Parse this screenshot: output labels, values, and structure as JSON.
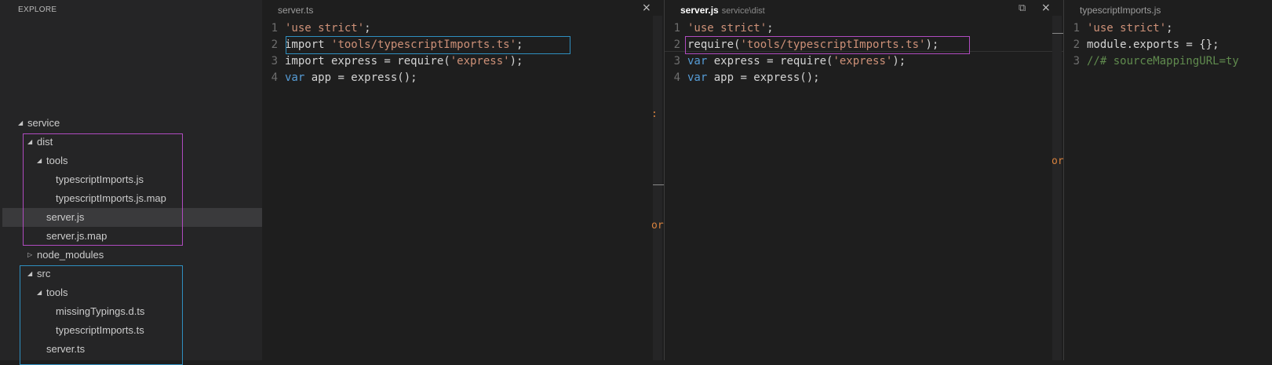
{
  "sidebar": {
    "title": "EXPLORE",
    "tree": [
      {
        "label": "service",
        "twisty": "◢"
      },
      {
        "label": "dist",
        "twisty": "◢"
      },
      {
        "label": "tools",
        "twisty": "◢"
      },
      {
        "label": "typescriptImports.js"
      },
      {
        "label": "typescriptImports.js.map"
      },
      {
        "label": "server.js",
        "selected": true
      },
      {
        "label": "server.js.map"
      },
      {
        "label": "node_modules",
        "twisty": "▷"
      },
      {
        "label": "src",
        "twisty": "◢"
      },
      {
        "label": "tools",
        "twisty": "◢"
      },
      {
        "label": "missingTypings.d.ts"
      },
      {
        "label": "typescriptImports.ts"
      },
      {
        "label": "server.ts"
      }
    ]
  },
  "editors": [
    {
      "tab": "server.ts",
      "lines": [
        {
          "n": "1",
          "tokens": [
            {
              "t": "'use strict'",
              "c": "str"
            },
            {
              "t": ";",
              "c": ""
            }
          ]
        },
        {
          "n": "2",
          "tokens": [
            {
              "t": "import ",
              "c": ""
            },
            {
              "t": "'tools/typescriptImports.ts'",
              "c": "str"
            },
            {
              "t": ";",
              "c": ""
            }
          ]
        },
        {
          "n": "3",
          "tokens": [
            {
              "t": "import express = require(",
              "c": ""
            },
            {
              "t": "'express'",
              "c": "str"
            },
            {
              "t": ");",
              "c": ""
            }
          ]
        },
        {
          "n": "4",
          "tokens": [
            {
              "t": "var",
              "c": "kw"
            },
            {
              "t": " app = express();",
              "c": ""
            }
          ]
        }
      ],
      "overflow_text": "or"
    },
    {
      "tab": "server.js",
      "tab_sub": "service\\dist",
      "lines": [
        {
          "n": "1",
          "tokens": [
            {
              "t": "'use strict'",
              "c": "str"
            },
            {
              "t": ";",
              "c": ""
            }
          ]
        },
        {
          "n": "2",
          "tokens": [
            {
              "t": "require(",
              "c": ""
            },
            {
              "t": "'tools/typescriptImports.ts'",
              "c": "str"
            },
            {
              "t": ");",
              "c": ""
            }
          ]
        },
        {
          "n": "3",
          "tokens": [
            {
              "t": "var",
              "c": "kw"
            },
            {
              "t": " express = require(",
              "c": ""
            },
            {
              "t": "'express'",
              "c": "str"
            },
            {
              "t": ");",
              "c": ""
            }
          ]
        },
        {
          "n": "4",
          "tokens": [
            {
              "t": "var",
              "c": "kw"
            },
            {
              "t": " app = express();",
              "c": ""
            }
          ]
        }
      ],
      "overflow_text": "or"
    },
    {
      "tab": "typescriptImports.js",
      "lines": [
        {
          "n": "1",
          "tokens": [
            {
              "t": "'use strict'",
              "c": "str"
            },
            {
              "t": ";",
              "c": ""
            }
          ]
        },
        {
          "n": "2",
          "tokens": [
            {
              "t": "module.exports = {};",
              "c": ""
            }
          ]
        },
        {
          "n": "3",
          "tokens": [
            {
              "t": "//# sourceMappingURL=ty",
              "c": "cmt"
            }
          ]
        }
      ]
    }
  ],
  "icons": {
    "close": "×",
    "split": "⧉"
  },
  "colors": {
    "highlight_purple": "#b04bc0",
    "highlight_blue": "#2f8fc0",
    "string": "#ce9178",
    "keyword": "#569cd6",
    "comment": "#608b4e"
  }
}
